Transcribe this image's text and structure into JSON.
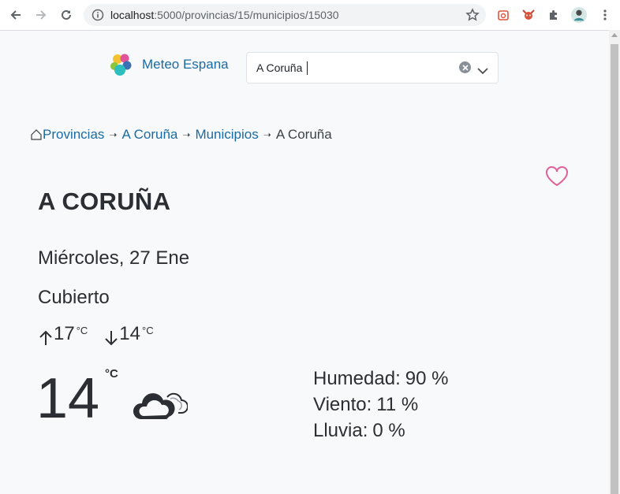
{
  "browser": {
    "url_host": "localhost",
    "url_path": ":5000/provincias/15/municipios/15030"
  },
  "app": {
    "brand_name": "Meteo Espana",
    "search": {
      "selected": "A Coruña"
    }
  },
  "breadcrumb": {
    "items": [
      "Provincias",
      "A Coruña",
      "Municipios"
    ],
    "current": "A Coruña"
  },
  "weather": {
    "city": "A CORUÑA",
    "date": "Miércoles, 27 Ene",
    "description": "Cubierto",
    "max": "17",
    "min": "14",
    "unit": "°C",
    "temperature": "14",
    "stats": [
      {
        "label": "Humedad:",
        "value": "90 %"
      },
      {
        "label": "Viento:",
        "value": "11 %"
      },
      {
        "label": "Lluvia:",
        "value": "0 %"
      }
    ]
  },
  "colors": {
    "link": "#1a6ba3",
    "heart": "#e0619a",
    "text": "#2b2e33"
  },
  "icons": [
    "back-arrow-icon",
    "forward-arrow-icon",
    "reload-icon",
    "info-icon",
    "star-icon",
    "extension-icon",
    "puzzle-icon",
    "profile-avatar",
    "kebab-menu-icon",
    "home-icon",
    "heart-icon",
    "cloud-icon",
    "arrow-up-icon",
    "arrow-down-icon"
  ]
}
